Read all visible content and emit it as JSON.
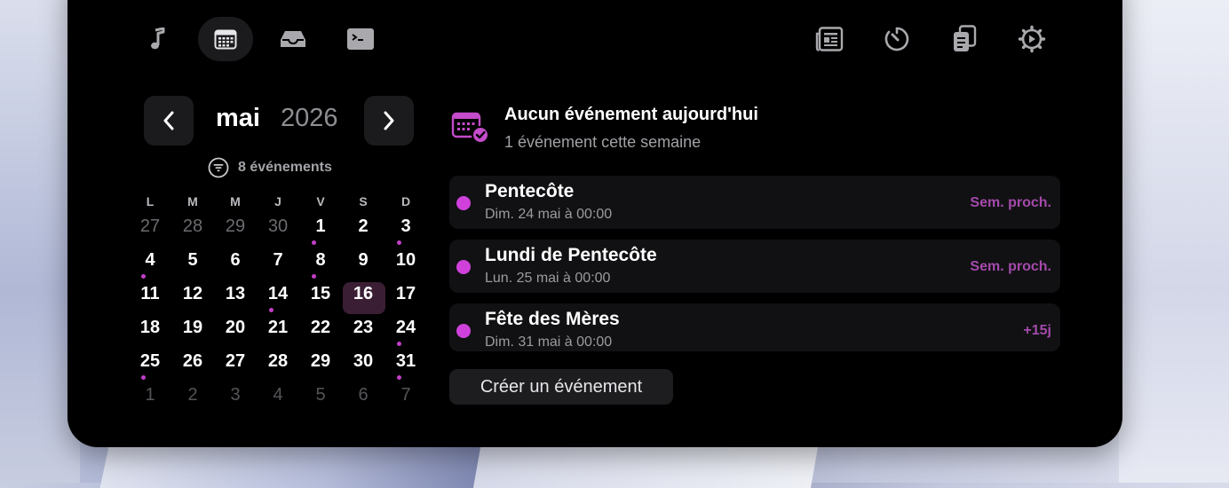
{
  "toolbar": {
    "left": [
      {
        "name": "music-icon",
        "active": false
      },
      {
        "name": "calendar-icon",
        "active": true
      },
      {
        "name": "inbox-icon",
        "active": false
      },
      {
        "name": "terminal-icon",
        "active": false
      }
    ],
    "right": [
      {
        "name": "news-icon"
      },
      {
        "name": "timer-icon"
      },
      {
        "name": "clipboard-icon"
      },
      {
        "name": "settings-icon"
      }
    ]
  },
  "calendar": {
    "month": "mai",
    "year": "2026",
    "event_count_label": "8 événements",
    "weekdays": [
      "L",
      "M",
      "M",
      "J",
      "V",
      "S",
      "D"
    ],
    "weeks": [
      [
        {
          "d": "27",
          "o": true
        },
        {
          "d": "28",
          "o": true
        },
        {
          "d": "29",
          "o": true
        },
        {
          "d": "30",
          "o": true
        },
        {
          "d": "1",
          "dot": true
        },
        {
          "d": "2"
        },
        {
          "d": "3",
          "dot": true
        }
      ],
      [
        {
          "d": "4",
          "dot": true
        },
        {
          "d": "5"
        },
        {
          "d": "6"
        },
        {
          "d": "7"
        },
        {
          "d": "8",
          "dot": true
        },
        {
          "d": "9"
        },
        {
          "d": "10"
        }
      ],
      [
        {
          "d": "11"
        },
        {
          "d": "12"
        },
        {
          "d": "13"
        },
        {
          "d": "14",
          "dot": true
        },
        {
          "d": "15"
        },
        {
          "d": "16",
          "today": true
        },
        {
          "d": "17"
        }
      ],
      [
        {
          "d": "18"
        },
        {
          "d": "19"
        },
        {
          "d": "20"
        },
        {
          "d": "21"
        },
        {
          "d": "22"
        },
        {
          "d": "23"
        },
        {
          "d": "24",
          "dot": true
        }
      ],
      [
        {
          "d": "25",
          "dot": true
        },
        {
          "d": "26"
        },
        {
          "d": "27"
        },
        {
          "d": "28"
        },
        {
          "d": "29"
        },
        {
          "d": "30"
        },
        {
          "d": "31",
          "dot": true
        }
      ],
      [
        {
          "d": "1",
          "o": true
        },
        {
          "d": "2",
          "o": true
        },
        {
          "d": "3",
          "o": true
        },
        {
          "d": "4",
          "o": true
        },
        {
          "d": "5",
          "o": true
        },
        {
          "d": "6",
          "o": true
        },
        {
          "d": "7",
          "o": true
        }
      ]
    ]
  },
  "summary": {
    "title": "Aucun événement aujourd'hui",
    "subtitle": "1 événement cette semaine"
  },
  "events": [
    {
      "title": "Pentecôte",
      "date": "Dim. 24 mai à 00:00",
      "relative": "Sem. proch."
    },
    {
      "title": "Lundi de Pentecôte",
      "date": "Lun. 25 mai à 00:00",
      "relative": "Sem. proch."
    },
    {
      "title": "Fête des Mères",
      "date": "Dim. 31 mai à 00:00",
      "relative": "+15j"
    }
  ],
  "create_button_label": "Créer un événement",
  "colors": {
    "accent": "#d041dc",
    "today_bg": "#3a1e34",
    "panel": "#000000"
  }
}
